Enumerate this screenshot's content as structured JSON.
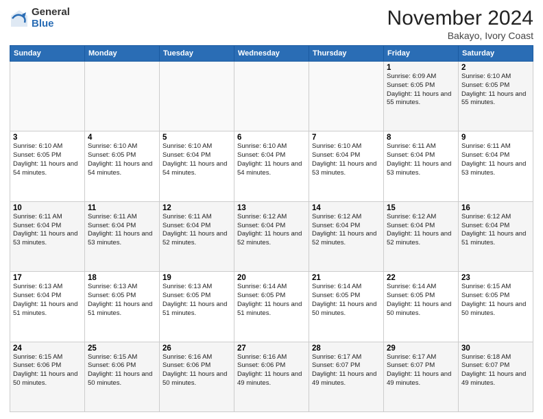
{
  "header": {
    "logo_general": "General",
    "logo_blue": "Blue",
    "month_title": "November 2024",
    "location": "Bakayo, Ivory Coast"
  },
  "days_of_week": [
    "Sunday",
    "Monday",
    "Tuesday",
    "Wednesday",
    "Thursday",
    "Friday",
    "Saturday"
  ],
  "weeks": [
    [
      {
        "day": "",
        "info": ""
      },
      {
        "day": "",
        "info": ""
      },
      {
        "day": "",
        "info": ""
      },
      {
        "day": "",
        "info": ""
      },
      {
        "day": "",
        "info": ""
      },
      {
        "day": "1",
        "info": "Sunrise: 6:09 AM\nSunset: 6:05 PM\nDaylight: 11 hours and 55 minutes."
      },
      {
        "day": "2",
        "info": "Sunrise: 6:10 AM\nSunset: 6:05 PM\nDaylight: 11 hours and 55 minutes."
      }
    ],
    [
      {
        "day": "3",
        "info": "Sunrise: 6:10 AM\nSunset: 6:05 PM\nDaylight: 11 hours and 54 minutes."
      },
      {
        "day": "4",
        "info": "Sunrise: 6:10 AM\nSunset: 6:05 PM\nDaylight: 11 hours and 54 minutes."
      },
      {
        "day": "5",
        "info": "Sunrise: 6:10 AM\nSunset: 6:04 PM\nDaylight: 11 hours and 54 minutes."
      },
      {
        "day": "6",
        "info": "Sunrise: 6:10 AM\nSunset: 6:04 PM\nDaylight: 11 hours and 54 minutes."
      },
      {
        "day": "7",
        "info": "Sunrise: 6:10 AM\nSunset: 6:04 PM\nDaylight: 11 hours and 53 minutes."
      },
      {
        "day": "8",
        "info": "Sunrise: 6:11 AM\nSunset: 6:04 PM\nDaylight: 11 hours and 53 minutes."
      },
      {
        "day": "9",
        "info": "Sunrise: 6:11 AM\nSunset: 6:04 PM\nDaylight: 11 hours and 53 minutes."
      }
    ],
    [
      {
        "day": "10",
        "info": "Sunrise: 6:11 AM\nSunset: 6:04 PM\nDaylight: 11 hours and 53 minutes."
      },
      {
        "day": "11",
        "info": "Sunrise: 6:11 AM\nSunset: 6:04 PM\nDaylight: 11 hours and 53 minutes."
      },
      {
        "day": "12",
        "info": "Sunrise: 6:11 AM\nSunset: 6:04 PM\nDaylight: 11 hours and 52 minutes."
      },
      {
        "day": "13",
        "info": "Sunrise: 6:12 AM\nSunset: 6:04 PM\nDaylight: 11 hours and 52 minutes."
      },
      {
        "day": "14",
        "info": "Sunrise: 6:12 AM\nSunset: 6:04 PM\nDaylight: 11 hours and 52 minutes."
      },
      {
        "day": "15",
        "info": "Sunrise: 6:12 AM\nSunset: 6:04 PM\nDaylight: 11 hours and 52 minutes."
      },
      {
        "day": "16",
        "info": "Sunrise: 6:12 AM\nSunset: 6:04 PM\nDaylight: 11 hours and 51 minutes."
      }
    ],
    [
      {
        "day": "17",
        "info": "Sunrise: 6:13 AM\nSunset: 6:04 PM\nDaylight: 11 hours and 51 minutes."
      },
      {
        "day": "18",
        "info": "Sunrise: 6:13 AM\nSunset: 6:05 PM\nDaylight: 11 hours and 51 minutes."
      },
      {
        "day": "19",
        "info": "Sunrise: 6:13 AM\nSunset: 6:05 PM\nDaylight: 11 hours and 51 minutes."
      },
      {
        "day": "20",
        "info": "Sunrise: 6:14 AM\nSunset: 6:05 PM\nDaylight: 11 hours and 51 minutes."
      },
      {
        "day": "21",
        "info": "Sunrise: 6:14 AM\nSunset: 6:05 PM\nDaylight: 11 hours and 50 minutes."
      },
      {
        "day": "22",
        "info": "Sunrise: 6:14 AM\nSunset: 6:05 PM\nDaylight: 11 hours and 50 minutes."
      },
      {
        "day": "23",
        "info": "Sunrise: 6:15 AM\nSunset: 6:05 PM\nDaylight: 11 hours and 50 minutes."
      }
    ],
    [
      {
        "day": "24",
        "info": "Sunrise: 6:15 AM\nSunset: 6:06 PM\nDaylight: 11 hours and 50 minutes."
      },
      {
        "day": "25",
        "info": "Sunrise: 6:15 AM\nSunset: 6:06 PM\nDaylight: 11 hours and 50 minutes."
      },
      {
        "day": "26",
        "info": "Sunrise: 6:16 AM\nSunset: 6:06 PM\nDaylight: 11 hours and 50 minutes."
      },
      {
        "day": "27",
        "info": "Sunrise: 6:16 AM\nSunset: 6:06 PM\nDaylight: 11 hours and 49 minutes."
      },
      {
        "day": "28",
        "info": "Sunrise: 6:17 AM\nSunset: 6:07 PM\nDaylight: 11 hours and 49 minutes."
      },
      {
        "day": "29",
        "info": "Sunrise: 6:17 AM\nSunset: 6:07 PM\nDaylight: 11 hours and 49 minutes."
      },
      {
        "day": "30",
        "info": "Sunrise: 6:18 AM\nSunset: 6:07 PM\nDaylight: 11 hours and 49 minutes."
      }
    ]
  ]
}
